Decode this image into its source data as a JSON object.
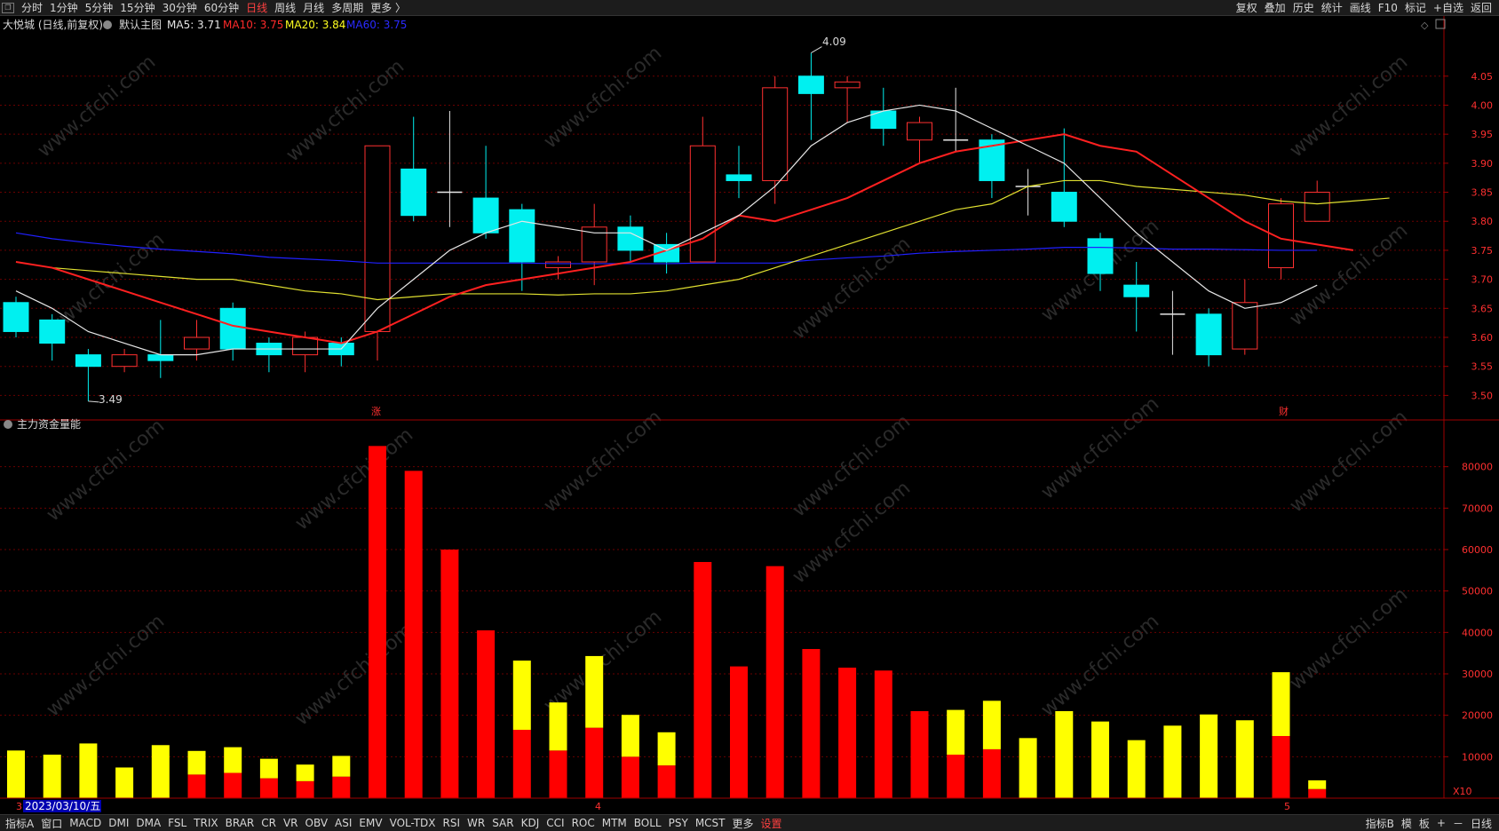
{
  "toolbar": {
    "left_items": [
      "分时",
      "1分钟",
      "5分钟",
      "15分钟",
      "30分钟",
      "60分钟",
      "日线",
      "周线",
      "月线",
      "多周期",
      "更多 〉"
    ],
    "active": "日线",
    "right_items": [
      "复权",
      "叠加",
      "历史",
      "统计",
      "画线",
      "F10",
      "标记",
      "+自选",
      "返回"
    ]
  },
  "main_panel": {
    "title": "大悦城 (日线,前复权)",
    "indicator_icon": "settings-icon",
    "template_label": "默认主图",
    "ma": [
      {
        "label": "MA5: 3.71",
        "color": "#e6e6e6"
      },
      {
        "label": "MA10: 3.75",
        "color": "#ff2a2a"
      },
      {
        "label": "MA20: 3.84",
        "color": "#ffff20"
      },
      {
        "label": "MA60: 3.75",
        "color": "#2a2aff"
      }
    ],
    "right_icons": [
      "diamond-icon",
      "window-icon"
    ]
  },
  "sub_panel": {
    "title": "主力资金量能",
    "unit": "X10"
  },
  "annotations": {
    "high": "4.09",
    "low": "3.49",
    "marker_zhang": "涨",
    "marker_cai": "财",
    "date_label": "2023/03/10/五",
    "month_4": "4",
    "month_5": "5",
    "month_3": "3"
  },
  "watermark": "www.cfchi.com",
  "bottombar": {
    "left_items": [
      "指标A",
      "窗口",
      "MACD",
      "DMI",
      "DMA",
      "FSL",
      "TRIX",
      "BRAR",
      "CR",
      "VR",
      "OBV",
      "ASI",
      "EMV",
      "VOL-TDX",
      "RSI",
      "WR",
      "SAR",
      "KDJ",
      "CCI",
      "ROC",
      "MTM",
      "BOLL",
      "PSY",
      "MCST",
      "更多",
      "设置"
    ],
    "warn_item": "设置",
    "right_items": [
      "指标B",
      "模",
      "板",
      "+",
      "－",
      "日线"
    ]
  },
  "colors": {
    "up": "#ff3030",
    "down": "#00f0f0",
    "ma5": "#e6e6e6",
    "ma10": "#ff2020",
    "ma20": "#e0e030",
    "ma60": "#2020ff",
    "bar_red": "#ff0000",
    "bar_yellow": "#ffff00",
    "grid": "#6a0000"
  },
  "chart_data": {
    "type": "candlestick",
    "price_axis": {
      "ticks": [
        "4.05",
        "4.00",
        "3.95",
        "3.90",
        "3.85",
        "3.80",
        "3.75",
        "3.70",
        "3.65",
        "3.60",
        "3.55",
        "3.50"
      ],
      "range": [
        3.47,
        4.12
      ]
    },
    "volume_axis": {
      "ticks": [
        "80000",
        "70000",
        "60000",
        "50000",
        "40000",
        "30000",
        "20000",
        "10000"
      ],
      "range": [
        0,
        87000
      ]
    },
    "candles": [
      {
        "o": 3.66,
        "h": 3.67,
        "l": 3.6,
        "c": 3.61
      },
      {
        "o": 3.63,
        "h": 3.64,
        "l": 3.56,
        "c": 3.59
      },
      {
        "o": 3.57,
        "h": 3.58,
        "l": 3.49,
        "c": 3.55
      },
      {
        "o": 3.55,
        "h": 3.58,
        "l": 3.54,
        "c": 3.57
      },
      {
        "o": 3.57,
        "h": 3.63,
        "l": 3.53,
        "c": 3.56
      },
      {
        "o": 3.58,
        "h": 3.63,
        "l": 3.56,
        "c": 3.6
      },
      {
        "o": 3.65,
        "h": 3.66,
        "l": 3.56,
        "c": 3.58
      },
      {
        "o": 3.59,
        "h": 3.6,
        "l": 3.54,
        "c": 3.57
      },
      {
        "o": 3.57,
        "h": 3.61,
        "l": 3.54,
        "c": 3.6
      },
      {
        "o": 3.59,
        "h": 3.6,
        "l": 3.55,
        "c": 3.57
      },
      {
        "o": 3.61,
        "h": 3.93,
        "l": 3.56,
        "c": 3.93
      },
      {
        "o": 3.89,
        "h": 3.98,
        "l": 3.8,
        "c": 3.81
      },
      {
        "o": 3.85,
        "h": 3.99,
        "l": 3.79,
        "c": 3.85
      },
      {
        "o": 3.84,
        "h": 3.93,
        "l": 3.77,
        "c": 3.78
      },
      {
        "o": 3.82,
        "h": 3.83,
        "l": 3.68,
        "c": 3.73
      },
      {
        "o": 3.72,
        "h": 3.74,
        "l": 3.7,
        "c": 3.73
      },
      {
        "o": 3.73,
        "h": 3.83,
        "l": 3.69,
        "c": 3.79
      },
      {
        "o": 3.79,
        "h": 3.81,
        "l": 3.73,
        "c": 3.75
      },
      {
        "o": 3.76,
        "h": 3.78,
        "l": 3.71,
        "c": 3.73
      },
      {
        "o": 3.73,
        "h": 3.98,
        "l": 3.73,
        "c": 3.93
      },
      {
        "o": 3.88,
        "h": 3.93,
        "l": 3.84,
        "c": 3.87
      },
      {
        "o": 3.87,
        "h": 4.05,
        "l": 3.83,
        "c": 4.03
      },
      {
        "o": 4.05,
        "h": 4.09,
        "l": 3.94,
        "c": 4.02
      },
      {
        "o": 4.03,
        "h": 4.05,
        "l": 3.97,
        "c": 4.04
      },
      {
        "o": 3.99,
        "h": 4.03,
        "l": 3.93,
        "c": 3.96
      },
      {
        "o": 3.94,
        "h": 3.98,
        "l": 3.9,
        "c": 3.97
      },
      {
        "o": 3.94,
        "h": 4.03,
        "l": 3.92,
        "c": 3.94
      },
      {
        "o": 3.94,
        "h": 3.95,
        "l": 3.84,
        "c": 3.87
      },
      {
        "o": 3.86,
        "h": 3.89,
        "l": 3.81,
        "c": 3.86
      },
      {
        "o": 3.85,
        "h": 3.96,
        "l": 3.79,
        "c": 3.8
      },
      {
        "o": 3.77,
        "h": 3.78,
        "l": 3.68,
        "c": 3.71
      },
      {
        "o": 3.69,
        "h": 3.73,
        "l": 3.61,
        "c": 3.67
      },
      {
        "o": 3.64,
        "h": 3.68,
        "l": 3.57,
        "c": 3.64
      },
      {
        "o": 3.64,
        "h": 3.65,
        "l": 3.55,
        "c": 3.57
      },
      {
        "o": 3.58,
        "h": 3.7,
        "l": 3.57,
        "c": 3.66
      },
      {
        "o": 3.72,
        "h": 3.84,
        "l": 3.7,
        "c": 3.83
      },
      {
        "o": 3.8,
        "h": 3.87,
        "l": 3.8,
        "c": 3.85
      }
    ],
    "ma5": [
      3.68,
      3.65,
      3.61,
      3.59,
      3.57,
      3.57,
      3.58,
      3.58,
      3.58,
      3.58,
      3.65,
      3.7,
      3.75,
      3.78,
      3.8,
      3.79,
      3.78,
      3.78,
      3.75,
      3.78,
      3.81,
      3.86,
      3.93,
      3.97,
      3.99,
      4.0,
      3.99,
      3.96,
      3.93,
      3.9,
      3.84,
      3.78,
      3.73,
      3.68,
      3.65,
      3.66,
      3.69
    ],
    "ma10": [
      3.73,
      3.72,
      3.7,
      3.68,
      3.66,
      3.64,
      3.62,
      3.61,
      3.6,
      3.59,
      3.61,
      3.64,
      3.67,
      3.69,
      3.7,
      3.71,
      3.72,
      3.73,
      3.75,
      3.77,
      3.81,
      3.8,
      3.82,
      3.84,
      3.87,
      3.9,
      3.92,
      3.93,
      3.94,
      3.95,
      3.93,
      3.92,
      3.88,
      3.84,
      3.8,
      3.77,
      3.76,
      3.75
    ],
    "ma20": [
      3.73,
      3.72,
      3.715,
      3.71,
      3.705,
      3.7,
      3.7,
      3.69,
      3.68,
      3.675,
      3.665,
      3.67,
      3.675,
      3.675,
      3.675,
      3.673,
      3.675,
      3.675,
      3.68,
      3.69,
      3.7,
      3.72,
      3.74,
      3.76,
      3.78,
      3.8,
      3.82,
      3.83,
      3.86,
      3.87,
      3.87,
      3.86,
      3.855,
      3.85,
      3.845,
      3.835,
      3.83,
      3.835,
      3.84
    ],
    "ma60": [
      3.78,
      3.77,
      3.763,
      3.757,
      3.752,
      3.748,
      3.744,
      3.738,
      3.735,
      3.732,
      3.728,
      3.728,
      3.728,
      3.728,
      3.728,
      3.727,
      3.727,
      3.727,
      3.727,
      3.728,
      3.728,
      3.728,
      3.733,
      3.737,
      3.74,
      3.745,
      3.748,
      3.75,
      3.752,
      3.755,
      3.755,
      3.754,
      3.752,
      3.752,
      3.751,
      3.75,
      3.75
    ],
    "volume": [
      {
        "red": 0,
        "yellow": 11500
      },
      {
        "red": 0,
        "yellow": 10500
      },
      {
        "red": 0,
        "yellow": 13200
      },
      {
        "red": 0,
        "yellow": 7400
      },
      {
        "red": 0,
        "yellow": 12800
      },
      {
        "red": 5700,
        "yellow": 5700
      },
      {
        "red": 6100,
        "yellow": 6200
      },
      {
        "red": 4800,
        "yellow": 4700
      },
      {
        "red": 4100,
        "yellow": 4000
      },
      {
        "red": 5200,
        "yellow": 5000
      },
      {
        "red": 85000,
        "yellow": 0
      },
      {
        "red": 79000,
        "yellow": 0
      },
      {
        "red": 60000,
        "yellow": 0
      },
      {
        "red": 40500,
        "yellow": 0
      },
      {
        "red": 16500,
        "yellow": 16700
      },
      {
        "red": 11500,
        "yellow": 11600
      },
      {
        "red": 17000,
        "yellow": 17300
      },
      {
        "red": 10000,
        "yellow": 10100
      },
      {
        "red": 7900,
        "yellow": 8000
      },
      {
        "red": 57000,
        "yellow": 0
      },
      {
        "red": 31800,
        "yellow": 0
      },
      {
        "red": 56000,
        "yellow": 0
      },
      {
        "red": 36000,
        "yellow": 0
      },
      {
        "red": 31500,
        "yellow": 0
      },
      {
        "red": 30800,
        "yellow": 0
      },
      {
        "red": 21000,
        "yellow": 0
      },
      {
        "red": 10500,
        "yellow": 10800
      },
      {
        "red": 11800,
        "yellow": 11700
      },
      {
        "red": 0,
        "yellow": 14500
      },
      {
        "red": 0,
        "yellow": 21000
      },
      {
        "red": 0,
        "yellow": 18500
      },
      {
        "red": 0,
        "yellow": 14000
      },
      {
        "red": 0,
        "yellow": 17500
      },
      {
        "red": 0,
        "yellow": 20200
      },
      {
        "red": 0,
        "yellow": 18800
      },
      {
        "red": 15000,
        "yellow": 15400
      },
      {
        "red": 2200,
        "yellow": 2100
      }
    ]
  }
}
